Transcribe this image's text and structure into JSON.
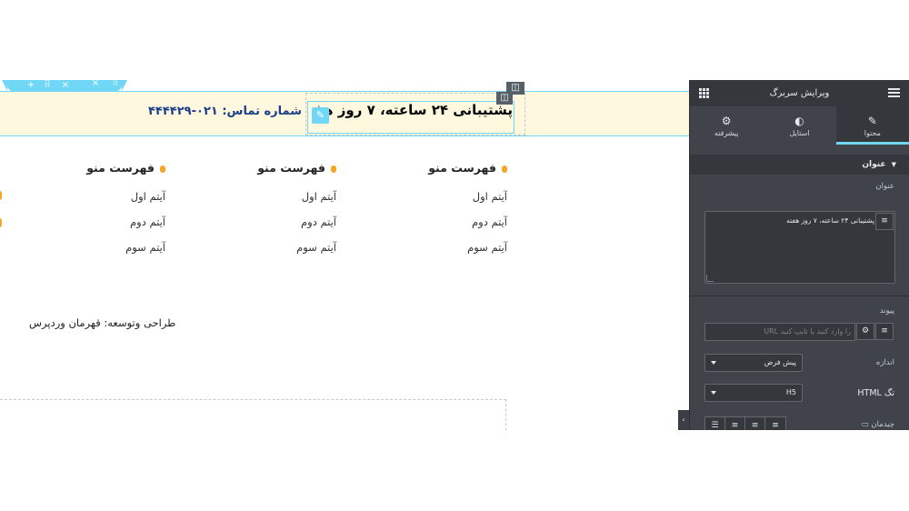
{
  "canvas": {
    "section_toolbar": {
      "add_symbol": "+",
      "drag_symbol": "⠿",
      "close_symbol": "×",
      "column_close_symbol": "×",
      "column_drag_symbol": "⠿"
    },
    "header": {
      "heading": "پشتیبانی ۲۴ ساعته، ۷ روز هفته",
      "contact": "شماره تماس: ۰۲۱-۴۴۴۴۲۹",
      "column_edit_symbol": "◫",
      "widget_edit_symbol": "◫",
      "pencil_symbol": "✎"
    },
    "menus": [
      {
        "title": "فهرست منو",
        "items": [
          "آیتم اول",
          "آیتم دوم",
          "آیتم سوم"
        ]
      },
      {
        "title": "فهرست منو",
        "items": [
          "آیتم اول",
          "آیتم دوم",
          "آیتم سوم"
        ]
      },
      {
        "title": "فهرست منو",
        "items": [
          "آیتم اول",
          "آیتم دوم",
          "آیتم سوم"
        ]
      }
    ],
    "credit": "طراحی وتوسعه: قهرمان وردپرس",
    "accent_color": "#71d7f7",
    "bullet_color": "#f5a623"
  },
  "panel": {
    "title": "ویرایش سربرگ",
    "tabs": [
      {
        "label": "محتوا",
        "icon": "pencil-icon",
        "glyph": "✎",
        "active": true
      },
      {
        "label": "استایل",
        "icon": "contrast-icon",
        "glyph": "◐",
        "active": false
      },
      {
        "label": "پیشرفته",
        "icon": "gear-icon",
        "glyph": "⚙",
        "active": false
      }
    ],
    "section_title": "عنوان",
    "title_label": "عنوان",
    "title_value": "پشتیبانی ۲۴ ساعته، ۷ روز هفته",
    "link_label": "پیوند",
    "link_placeholder": "را وارد کنید یا تایپ کنید URL",
    "size_label": "اندازه",
    "size_value": "پیش فرض",
    "html_tag_label": "تگ HTML",
    "html_tag_value": "H5",
    "alignment_label": "چیدمان",
    "alignment_options": [
      "justify",
      "right",
      "center",
      "left"
    ],
    "db_symbol": "≡",
    "gear_symbol": "⚙",
    "collapse_symbol": "‹",
    "colors": {
      "panel_bg": "#404349",
      "header_bg": "#34383c",
      "active_tab_indicator": "#71d7f7"
    }
  }
}
